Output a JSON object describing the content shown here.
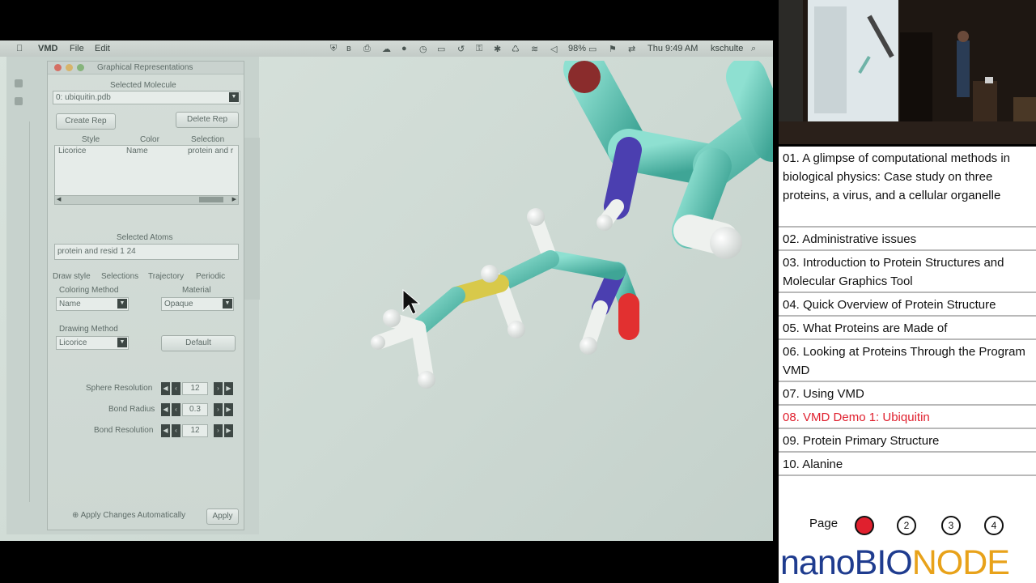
{
  "menubar": {
    "apple": "",
    "app_name": "VMD",
    "menus": [
      "File",
      "Edit"
    ],
    "battery": "98%",
    "clock": "Thu 9:49 AM",
    "user": "kschulte"
  },
  "panel": {
    "window_title": "Graphical Representations",
    "selected_molecule_label": "Selected Molecule",
    "selected_molecule_value": "0: ubiquitin.pdb",
    "create_rep": "Create Rep",
    "delete_rep": "Delete Rep",
    "columns": [
      "Style",
      "Color",
      "Selection"
    ],
    "reps": [
      {
        "style": "Licorice",
        "color": "Name",
        "selection": "protein and r"
      }
    ],
    "selected_atoms_label": "Selected Atoms",
    "selected_atoms_value": "protein and resid 1 24",
    "tabs": [
      "Draw style",
      "Selections",
      "Trajectory",
      "Periodic"
    ],
    "coloring_method_label": "Coloring Method",
    "coloring_method_value": "Name",
    "material_label": "Material",
    "material_value": "Opaque",
    "drawing_method_label": "Drawing Method",
    "drawing_method_value": "Licorice",
    "default_button": "Default",
    "params": [
      {
        "label": "Sphere Resolution",
        "value": "12"
      },
      {
        "label": "Bond Radius",
        "value": "0.3"
      },
      {
        "label": "Bond Resolution",
        "value": "12"
      }
    ],
    "apply_auto": "Apply Changes Automatically",
    "apply_button": "Apply"
  },
  "toc": {
    "items": [
      {
        "label": "01. A glimpse of computational methods in biological physics: Case study on three proteins, a virus, and a cellular organelle",
        "active": false
      },
      {
        "label": "02. Administrative issues",
        "active": false
      },
      {
        "label": "03. Introduction to Protein Structures and Molecular Graphics Tool",
        "active": false
      },
      {
        "label": "04. Quick Overview of Protein Structure",
        "active": false
      },
      {
        "label": "05. What Proteins are Made of",
        "active": false
      },
      {
        "label": "06. Looking at Proteins Through the Program VMD",
        "active": false
      },
      {
        "label": "07. Using VMD",
        "active": false
      },
      {
        "label": "08. VMD Demo 1: Ubiquitin",
        "active": true
      },
      {
        "label": "09. Protein Primary Structure",
        "active": false
      },
      {
        "label": "10. Alanine",
        "active": false
      }
    ],
    "active_color": "#e0202e"
  },
  "pager": {
    "label": "Page",
    "pages": [
      "1",
      "2",
      "3",
      "4"
    ],
    "current": "1",
    "current_color": "#e0202e"
  },
  "brand": {
    "part1": "nano",
    "part2": "BIO",
    "part3": "NODE",
    "colors": {
      "nano": "#1f3c8f",
      "bio": "#1f3c8f",
      "node": "#e8a21a"
    }
  },
  "colors": {
    "carbon": "#5fc4b4",
    "hydrogen": "#eef1ee",
    "nitrogen": "#4b3fb0",
    "oxygen": "#e23030",
    "sulfur": "#d8c94a"
  }
}
